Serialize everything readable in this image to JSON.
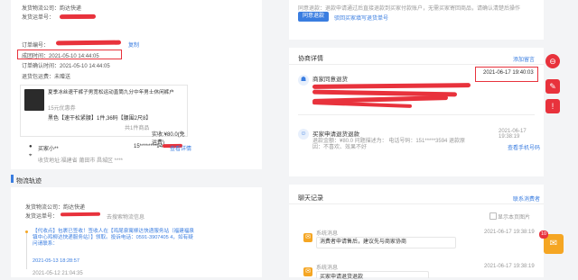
{
  "order": {
    "carrier_label": "发货物流公司：",
    "carrier_value": "韵达快递",
    "tracking_label": "发货运单号：",
    "paid_label": "订单编号：",
    "copy_label": "复制",
    "deal_time_label": "成团时间：",
    "deal_time_value": "2021-05-10 14:44:05",
    "confirm_time_label": "订单确认时间：",
    "confirm_time_value": "2021-05-10 14:44:05",
    "refund_status_label": "退货包运费：",
    "refund_status_value": "未赠送"
  },
  "product": {
    "title": "夏季冰丝速干裤子男宽松运动直筒九分中年男士休闲裤户",
    "coupon": "15元优惠券",
    "spec": "黑色【速干松紧腰】1件,36码【腰围2尺8】",
    "qty": "共1件商品",
    "price": "实收:¥80.0(免运费)"
  },
  "buyer": {
    "name": "买家小**",
    "phone": "15********94",
    "phone_tag": "南田市 昌城区 ****",
    "view_detail": "查看详情",
    "address": "收货地址:福建省 莆田市 昌城区 ****"
  },
  "logistics": {
    "title": "物流轨迹",
    "carrier_label": "发货物流公司：",
    "carrier_value": "韵达快递",
    "tracking_label": "发货运单号：",
    "query_link": "去搜索物流信息",
    "event_text": "【代收点】包裹已签收！签收人在【鸡尾泉寓柳达快递服务站（福建福泉镇中心鸡柳达快递服务站）】领取。投诉电话：0591-3907405 4，如有疑问请联系：",
    "event_phone": "0591-3907405 4",
    "event_time": "2021-05-13 18:28:57",
    "event_time2": "2021-05-12 21:04:35",
    "dot_label": "已签收"
  },
  "refund_notice": {
    "text": "同意退款：退款申请通过后直接退款到买家付款账户，无需买家寄回商品，请确认清楚后操作",
    "agree_button": "同意退款",
    "refuse_link": "驳回买家填写退货单号"
  },
  "negotiation": {
    "title": "协商详情",
    "add_note": "添加留言",
    "event1_title": "商家同意退货",
    "event1_time": "2021-06-17 19:40:03",
    "event2_title": "买家申请退货退款",
    "event2_time": "2021-06-17 19:38:19",
    "event2_detail": "退款金额：¥80.0  问题描述为：  电话号码：151*****3594  退款原因：不喜欢、效果不好",
    "view_link": "查看手机号码"
  },
  "chat": {
    "title": "聊天记录",
    "view_all": "联系消费者",
    "show_current": "显示本页图片",
    "msg1_sender": "系统消息",
    "msg1_time": "2021-06-17 19:38:19",
    "msg1_text": "消费者申请售后，建议先与商家协商",
    "msg2_sender": "系统消息",
    "msg2_time": "2021-06-17 19:38:19",
    "msg2_text": "买家申请退货退款"
  },
  "floating": {
    "badge": "10"
  },
  "colors": {
    "accent": "#3a7de0",
    "highlight": "#e8323c",
    "warning": "#f5a623"
  }
}
